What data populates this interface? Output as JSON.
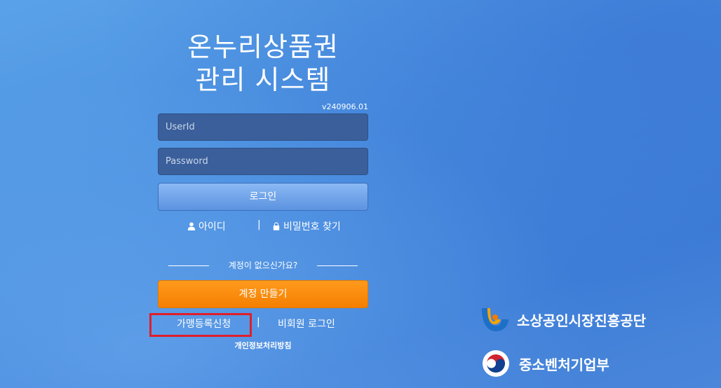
{
  "header": {
    "title_line1": "온누리상품권",
    "title_line2": "관리 시스템",
    "version": "v240906.01"
  },
  "form": {
    "userid_placeholder": "UserId",
    "password_placeholder": "Password",
    "login_label": "로그인"
  },
  "links": {
    "find_id_label": "아이디",
    "separator": "|",
    "find_password_label": "비밀번호 찾기"
  },
  "signup": {
    "divider_text": "계정이 없으신가요?",
    "create_account_label": "계정 만들기"
  },
  "bottom_links": {
    "merchant_register_label": "가맹등록신청",
    "separator": "|",
    "guest_login_label": "비회원 로그인",
    "privacy_label": "개인정보처리방침"
  },
  "orgs": [
    {
      "name": "소상공인시장진흥공단",
      "icon": "semas-logo-icon"
    },
    {
      "name": "중소벤처기업부",
      "icon": "taeguk-logo-icon"
    }
  ],
  "colors": {
    "background": "#4a8fe0",
    "login_button": "#6ea3ea",
    "signup_button": "#f7870a",
    "highlight_box": "#e01e2a"
  }
}
